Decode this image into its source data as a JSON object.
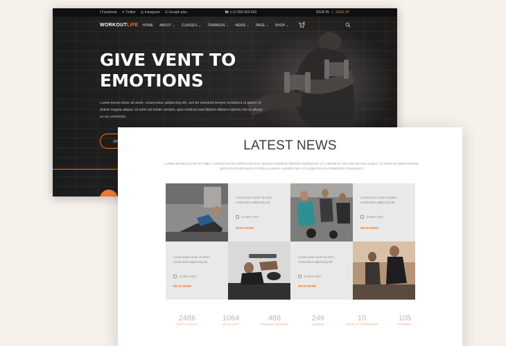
{
  "hero": {
    "topbar": {
      "social": [
        "Facebook",
        "Twitter",
        "Instagram",
        "Google plus"
      ],
      "phone": "(+1) 555-462-642",
      "signin": "SIGN IN",
      "separator": "|",
      "signup": "SIGN UP"
    },
    "logo_part1": "WORKOUT",
    "logo_part2": "LIFE",
    "menu": [
      "HOME",
      "ABOUT ⌄",
      "CLASSES ⌄",
      "TRAINERS ⌄",
      "NEWS ⌄",
      "PAGE ⌄",
      "SHOP ⌄"
    ],
    "title_line1": "GIVE VENT TO",
    "title_line2": "EMOTIONS",
    "text": "Lorem ipsum dolor sit amet, consectetur adipiscing elit, sed do eiusmod tempor incididunt ut labore et dolore magna aliqua. Ut enim ad minim veniam, quis nostrud exercitation ullamco laboris nisi ut aliquip ex ea commodo.",
    "button": "JOIN",
    "accent": "#f07a2c"
  },
  "news": {
    "title": "LATEST NEWS",
    "intro": "LOREM IPSUM DOLOR SIT AMET, CONSECTETUR ADIPISCING ELIT, SED DO EIUSMOD TEMPOR INCIDIDUNT UT LABORE ET DOLORE MAGNA ALIQUA. UT ENIM AD MINIM VENIAM, QUIS NOSTRUD EXERCITATION ULLAMCO LABORIS NISI UT ALIQUIP EX EA COMMODO CONSEQUAT.",
    "cards": [
      {
        "text": "Lorem ipsum dolor sit amet, consectetur adipiscing elit.",
        "date": "12 MAY 2017",
        "more": "READ MORE"
      },
      {
        "text": "Lorem ipsum dolor sit amet, consectetur adipiscing elit.",
        "date": "12 MAY 2017",
        "more": "READ MORE"
      },
      {
        "text": "Lorem ipsum dolor sit amet, consectetur adipiscing elit.",
        "date": "12 MAY 2017",
        "more": "READ MORE"
      },
      {
        "text": "Lorem ipsum dolor sit amet, consectetur adipiscing elit.",
        "date": "12 MAY 2017",
        "more": "READ MORE"
      }
    ],
    "stats": [
      {
        "num": "2486",
        "label": "HAPPY CLIENTS"
      },
      {
        "num": "1064",
        "label": "WORKOUTS"
      },
      {
        "num": "486",
        "label": "TRAINING SESSIONS"
      },
      {
        "num": "246",
        "label": "AWARDS"
      },
      {
        "num": "10",
        "label": "YEARS OF EXPERIENCE"
      },
      {
        "num": "105",
        "label": "TRAINERS"
      }
    ]
  }
}
